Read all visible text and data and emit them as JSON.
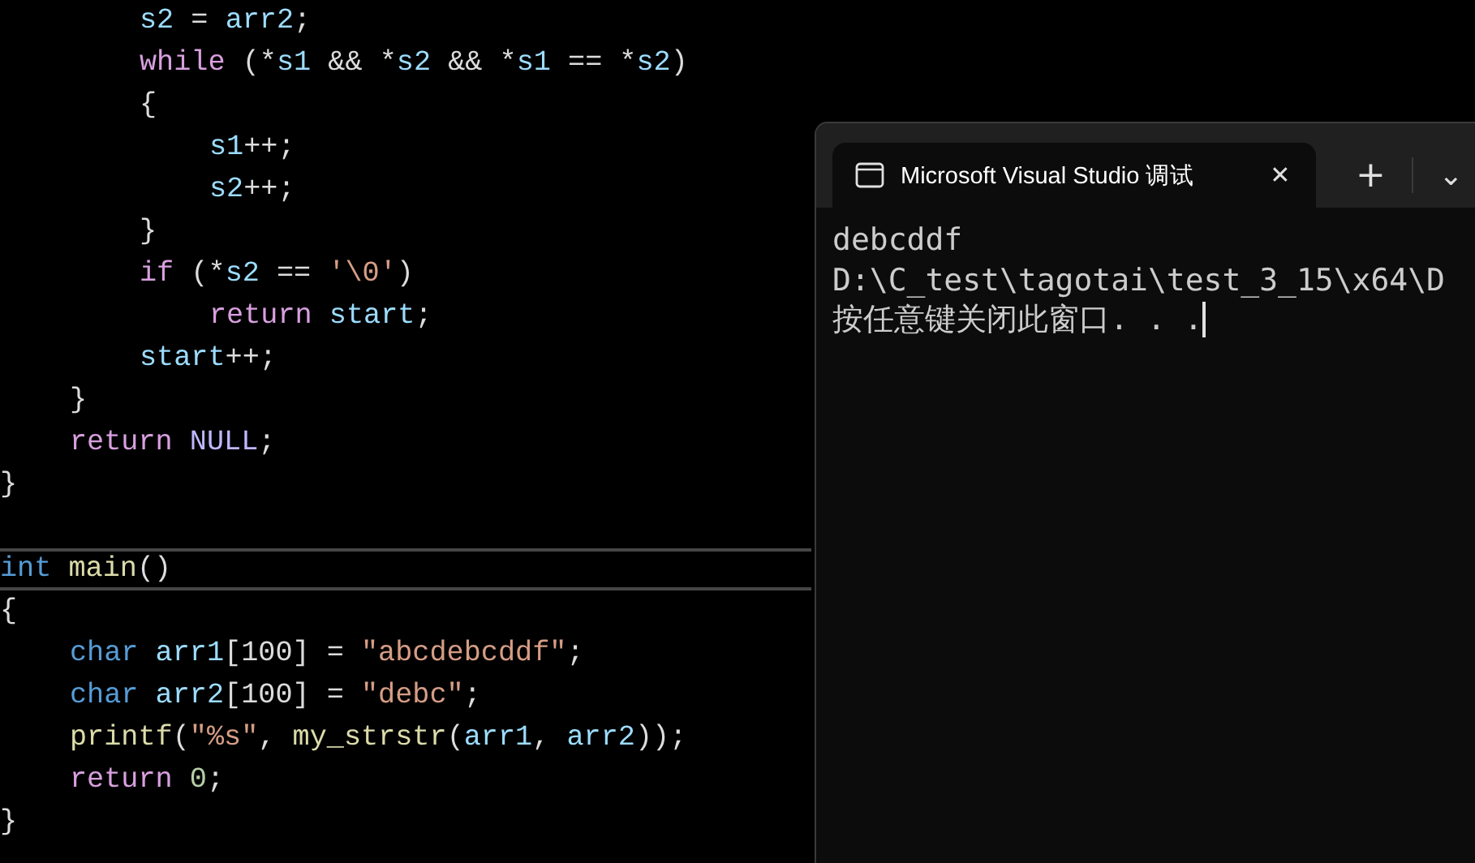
{
  "editor": {
    "lines": [
      {
        "children": [
          {
            "children": [
              {
                "kind": "code",
                "current": false,
                "tokens": [
                  {
                    "kind": "var",
                    "text": "s2"
                  },
                  {
                    "kind": "plain",
                    "text": " = "
                  },
                  {
                    "kind": "var",
                    "text": "arr2"
                  },
                  {
                    "kind": "plain",
                    "text": ";"
                  }
                ]
              },
              {
                "kind": "code",
                "current": false,
                "tokens": [
                  {
                    "kind": "control",
                    "text": "while"
                  },
                  {
                    "kind": "plain",
                    "text": " (*"
                  },
                  {
                    "kind": "var",
                    "text": "s1"
                  },
                  {
                    "kind": "plain",
                    "text": " && *"
                  },
                  {
                    "kind": "var",
                    "text": "s2"
                  },
                  {
                    "kind": "plain",
                    "text": " && *"
                  },
                  {
                    "kind": "var",
                    "text": "s1"
                  },
                  {
                    "kind": "plain",
                    "text": " == *"
                  },
                  {
                    "kind": "var",
                    "text": "s2"
                  },
                  {
                    "kind": "plain",
                    "text": ")"
                  }
                ]
              },
              {
                "kind": "code",
                "current": false,
                "tokens": [
                  {
                    "kind": "plain",
                    "text": "{"
                  }
                ],
                "children": [
                  {
                    "kind": "code",
                    "current": false,
                    "tokens": [
                      {
                        "kind": "var",
                        "text": "s1"
                      },
                      {
                        "kind": "plain",
                        "text": "++;"
                      }
                    ]
                  },
                  {
                    "kind": "code",
                    "current": false,
                    "tokens": [
                      {
                        "kind": "var",
                        "text": "s2"
                      },
                      {
                        "kind": "plain",
                        "text": "++;"
                      }
                    ]
                  }
                ]
              },
              {
                "kind": "code",
                "current": false,
                "tokens": [
                  {
                    "kind": "plain",
                    "text": "}"
                  }
                ]
              },
              {
                "kind": "code",
                "current": false,
                "tokens": [
                  {
                    "kind": "control",
                    "text": "if"
                  },
                  {
                    "kind": "plain",
                    "text": " (*"
                  },
                  {
                    "kind": "var",
                    "text": "s2"
                  },
                  {
                    "kind": "plain",
                    "text": " == "
                  },
                  {
                    "kind": "string",
                    "text": "'\\0'"
                  },
                  {
                    "kind": "plain",
                    "text": ")"
                  }
                ],
                "children": [
                  {
                    "kind": "code",
                    "current": false,
                    "tokens": [
                      {
                        "kind": "control",
                        "text": "return"
                      },
                      {
                        "kind": "var",
                        "text": " start"
                      },
                      {
                        "kind": "plain",
                        "text": ";"
                      }
                    ]
                  }
                ]
              },
              {
                "kind": "code",
                "current": false,
                "tokens": [
                  {
                    "kind": "var",
                    "text": "start"
                  },
                  {
                    "kind": "plain",
                    "text": "++;"
                  }
                ]
              }
            ]
          },
          {
            "kind": "code",
            "current": false,
            "tokens": [
              {
                "kind": "plain",
                "text": "}"
              }
            ]
          },
          {
            "kind": "code",
            "current": false,
            "tokens": [
              {
                "kind": "control",
                "text": "return"
              },
              {
                "kind": "macro",
                "text": " NULL"
              },
              {
                "kind": "plain",
                "text": ";"
              }
            ]
          }
        ]
      },
      {
        "kind": "code",
        "current": false,
        "tokens": [
          {
            "kind": "plain",
            "text": "}"
          }
        ]
      },
      {
        "kind": "blank",
        "current": false
      },
      {
        "kind": "code",
        "current": true,
        "tokens": [
          {
            "kind": "type",
            "text": "int"
          },
          {
            "kind": "function",
            "text": " main"
          },
          {
            "kind": "plain",
            "text": "()"
          }
        ]
      },
      {
        "kind": "code",
        "current": false,
        "tokens": [
          {
            "kind": "plain",
            "text": "{"
          }
        ],
        "children": [
          {
            "kind": "code",
            "current": false,
            "tokens": [
              {
                "kind": "type",
                "text": "char"
              },
              {
                "kind": "var",
                "text": " arr1"
              },
              {
                "kind": "plain",
                "text": "[100] = "
              },
              {
                "kind": "string",
                "text": "\"abcdebcddf\""
              },
              {
                "kind": "plain",
                "text": ";"
              }
            ]
          },
          {
            "kind": "code",
            "current": false,
            "tokens": [
              {
                "kind": "type",
                "text": "char"
              },
              {
                "kind": "var",
                "text": " arr2"
              },
              {
                "kind": "plain",
                "text": "[100] = "
              },
              {
                "kind": "string",
                "text": "\"debc\""
              },
              {
                "kind": "plain",
                "text": ";"
              }
            ]
          },
          {
            "kind": "code",
            "current": false,
            "tokens": [
              {
                "kind": "function",
                "text": "printf"
              },
              {
                "kind": "plain",
                "text": "("
              },
              {
                "kind": "string",
                "text": "\"%s\""
              },
              {
                "kind": "plain",
                "text": ", "
              },
              {
                "kind": "function",
                "text": "my_strstr"
              },
              {
                "kind": "plain",
                "text": "("
              },
              {
                "kind": "var",
                "text": "arr1"
              },
              {
                "kind": "plain",
                "text": ", "
              },
              {
                "kind": "var",
                "text": "arr2"
              },
              {
                "kind": "plain",
                "text": "));"
              }
            ]
          },
          {
            "kind": "code",
            "current": false,
            "tokens": [
              {
                "kind": "control",
                "text": "return"
              },
              {
                "kind": "number",
                "text": " 0"
              },
              {
                "kind": "plain",
                "text": ";"
              }
            ]
          }
        ]
      },
      {
        "kind": "code",
        "current": false,
        "tokens": [
          {
            "kind": "plain",
            "text": "}"
          }
        ]
      }
    ]
  },
  "terminal": {
    "tab": {
      "title": "Microsoft Visual Studio 调试",
      "close": "✕"
    },
    "new_tab": "+",
    "dropdown": "⌄",
    "output": [
      "debcddf",
      "D:\\C_test\\tagotai\\test_3_15\\x64\\D",
      "按任意键关闭此窗口. . ."
    ]
  }
}
